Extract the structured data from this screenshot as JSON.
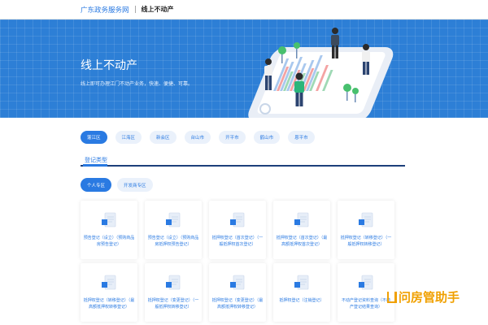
{
  "header": {
    "site_name": "广东政务服务网",
    "page_name": "线上不动产"
  },
  "banner": {
    "title": "线上不动产",
    "subtitle": "线上即可办理江门不动产业务，快速、便捷、可靠。"
  },
  "regions": [
    {
      "label": "蓬江区",
      "active": true
    },
    {
      "label": "江海区",
      "active": false
    },
    {
      "label": "新会区",
      "active": false
    },
    {
      "label": "台山市",
      "active": false
    },
    {
      "label": "开平市",
      "active": false
    },
    {
      "label": "鹤山市",
      "active": false
    },
    {
      "label": "恩平市",
      "active": false
    }
  ],
  "section": {
    "title": "登记类型"
  },
  "subtabs": [
    {
      "label": "个人专区",
      "active": true
    },
    {
      "label": "开发商专区",
      "active": false
    }
  ],
  "cards": [
    {
      "label": "预告登记（设立）（预购商品房预告登记）"
    },
    {
      "label": "预告登记（设立）（预购商品房抵押权预告登记）"
    },
    {
      "label": "抵押权登记（首次登记）（一般抵押权首次登记）"
    },
    {
      "label": "抵押权登记（首次登记）（最高额抵押权首次登记）"
    },
    {
      "label": "抵押权登记（转移登记）（一般抵押权转移登记）"
    },
    {
      "label": "抵押权登记（转移登记）（最高额抵押权转移登记）"
    },
    {
      "label": "抵押权登记（变更登记）（一般抵押权转移登记）"
    },
    {
      "label": "抵押权登记（变更登记）（最高额抵押权转移登记）"
    },
    {
      "label": "抵押权登记（注销登记）"
    },
    {
      "label": "不动产登记资料查询（不动产登记结果查询）"
    }
  ],
  "watermark": {
    "text": "问房管助手"
  },
  "colors": {
    "primary": "#2a7ae2",
    "banner": "#2d7fd6",
    "navy": "#1c3f7a"
  }
}
